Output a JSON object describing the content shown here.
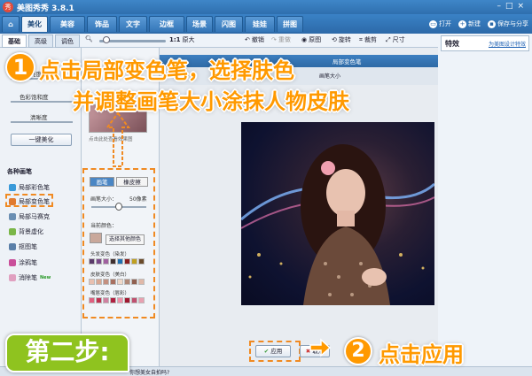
{
  "app": {
    "title": "美图秀秀 3.8.1",
    "logo": "秀"
  },
  "main_tabs": [
    "美化",
    "美容",
    "饰品",
    "文字",
    "边框",
    "场景",
    "闪图",
    "娃娃",
    "拼图"
  ],
  "top_actions": {
    "open": "打开",
    "new": "新建",
    "save": "保存与分享"
  },
  "sub_tabs": [
    "基础",
    "高级",
    "调色"
  ],
  "toolbar": {
    "zoom_label": "1:1",
    "original_size": "原大",
    "undo": "撤销",
    "redo": "重做",
    "original": "原图",
    "rotate": "旋转",
    "crop": "裁剪",
    "resize": "尺寸"
  },
  "right_panel": {
    "title": "特效",
    "link": "为美图设计特效"
  },
  "left": {
    "brightness": "亮度",
    "saturation": "色彩饱和度",
    "sharpness": "清晰度",
    "onekey": "一键美化",
    "brushes_title": "各种画笔",
    "brushes": [
      "局部彩色笔",
      "局部变色笔",
      "局部马赛克",
      "背景虚化",
      "抠图笔",
      "涂鸦笔",
      "消除笔"
    ],
    "new_badge": "New"
  },
  "thumb_hint": "点击此处查看效果图",
  "brush_panel": {
    "tab_brush": "画笔",
    "tab_eraser": "橡皮擦",
    "size_label": "画笔大小：",
    "size_value": "50像素",
    "current_color": "当前颜色：",
    "choose_color": "选择其他颜色",
    "hair": "头发变色（染发）",
    "skin": "皮肤变色（美白）",
    "lips": "嘴唇变色（唇彩）",
    "hair_colors": [
      "#5a3a6a",
      "#7a4a8a",
      "#a060a0",
      "#3f2f2f",
      "#1f6fb0",
      "#8a2020",
      "#c0a020",
      "#6a4a2a"
    ],
    "skin_colors": [
      "#e8c0b0",
      "#d9a892",
      "#c49080",
      "#a87060",
      "#f0d8c8",
      "#b08878",
      "#906050",
      "#e0b8a8"
    ],
    "lip_colors": [
      "#e06080",
      "#c03050",
      "#d080a0",
      "#b02040",
      "#f090a8",
      "#a01830",
      "#c05070",
      "#e8a0b0"
    ]
  },
  "dialog": {
    "title": "局部变色笔",
    "brush_size_ctrl": "画笔大小"
  },
  "buttons": {
    "apply": "应用",
    "cancel": "取消"
  },
  "status": {
    "text": "你想美女自拍吗?"
  },
  "annotations": {
    "step1_num": "1",
    "step1_line1": "点击局部变色笔，选择肤色",
    "step1_line2": "并调整画笔大小涂抹人物皮肤",
    "step2_num": "2",
    "step2_text": "点击应用",
    "step_badge": "第二步:"
  }
}
